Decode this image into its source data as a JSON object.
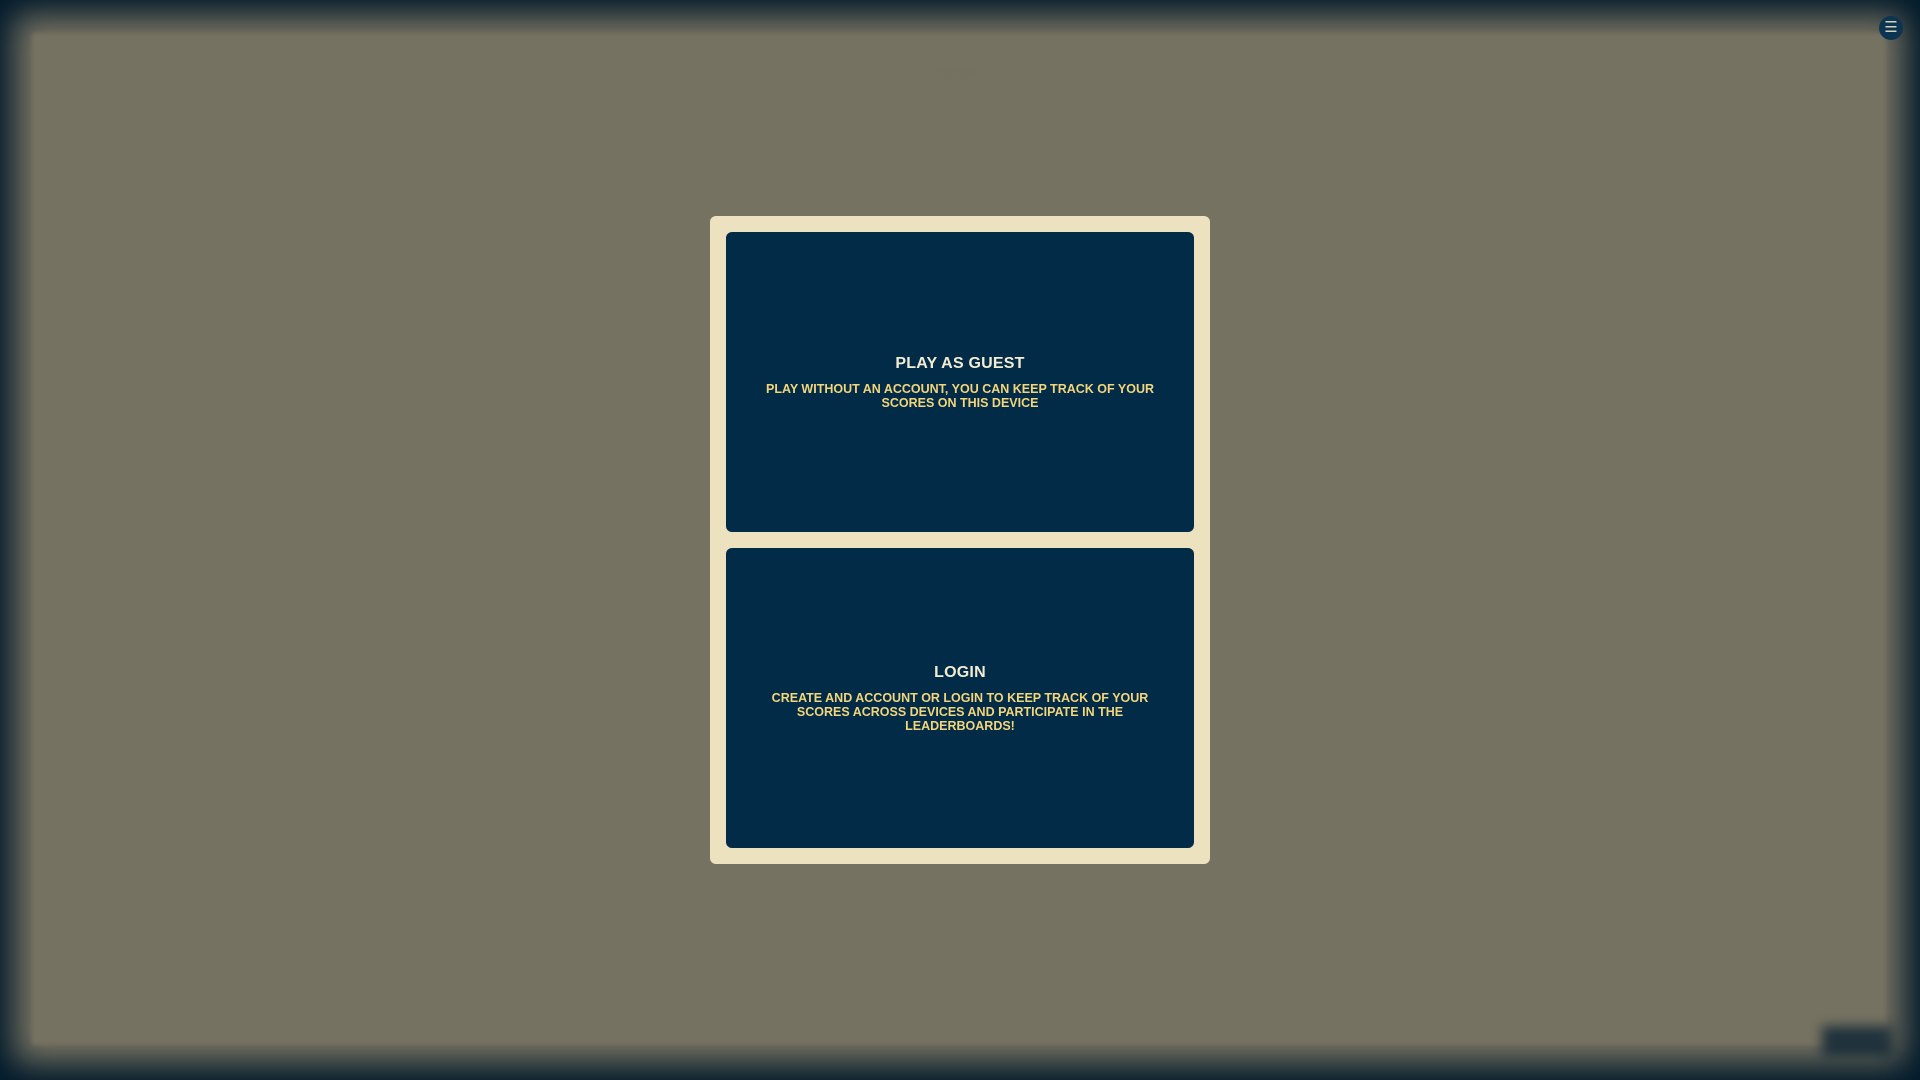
{
  "page": {
    "blurred_title": "········",
    "menu_icon": "hamburger-menu-icon"
  },
  "modal": {
    "guest": {
      "title": "PLAY AS GUEST",
      "description": "PLAY WITHOUT AN ACCOUNT, YOU CAN KEEP TRACK OF YOUR SCORES ON THIS DEVICE"
    },
    "login": {
      "title": "LOGIN",
      "description": "CREATE AND ACCOUNT OR LOGIN TO KEEP TRACK OF YOUR SCORES ACROSS DEVICES AND PARTICIPATE IN THE LEADERBOARDS!"
    }
  },
  "colors": {
    "outer_background": "#021a2b",
    "backdrop": "#767261",
    "modal_background": "#ece2bf",
    "card_background": "#022b47",
    "card_title": "#f4ecd2",
    "card_description": "#f3d57b"
  }
}
